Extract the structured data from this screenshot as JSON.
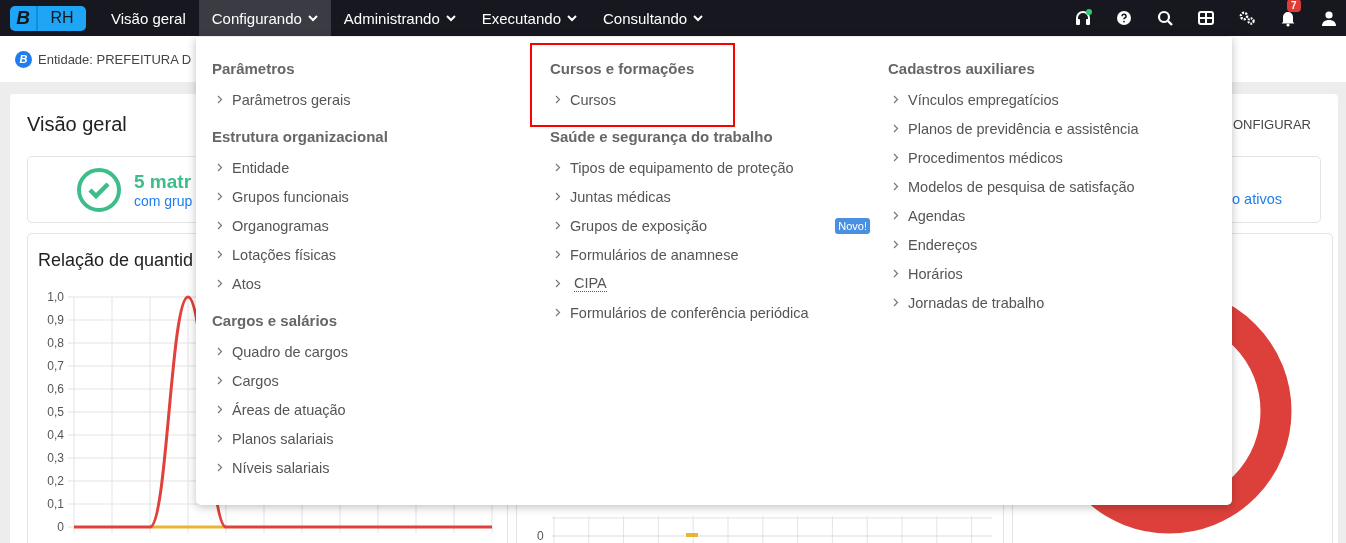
{
  "navbar": {
    "logo": {
      "letter": "B",
      "text": "RH"
    },
    "items": [
      {
        "label": "Visão geral",
        "selected": false,
        "dropdown": false
      },
      {
        "label": "Configurando",
        "selected": true,
        "dropdown": true
      },
      {
        "label": "Administrando",
        "selected": false,
        "dropdown": true
      },
      {
        "label": "Executando",
        "selected": false,
        "dropdown": true
      },
      {
        "label": "Consultando",
        "selected": false,
        "dropdown": true
      }
    ],
    "actions": [
      {
        "kind": "headset",
        "online": true
      },
      {
        "kind": "help"
      },
      {
        "kind": "search"
      },
      {
        "kind": "grid"
      },
      {
        "kind": "gears"
      },
      {
        "kind": "bell",
        "badge": "7"
      },
      {
        "kind": "user"
      }
    ]
  },
  "entity_bar": {
    "logo_letter": "B",
    "text": "Entidade: PREFEITURA D"
  },
  "overview": {
    "title": "Visão geral",
    "configure": "ONFIGURAR",
    "summary": {
      "count": "5 matr",
      "subtitle": "com grup",
      "right_link": "o ativos"
    },
    "line_chart": {
      "title": "Relação de quantid",
      "chart_data": {
        "type": "line",
        "grid": true,
        "series": [
          {
            "color": "#e0413a",
            "values": [
              0,
              0,
              0,
              1,
              0,
              0,
              0,
              0,
              0,
              0,
              0,
              0
            ]
          },
          {
            "color": "#e8b530",
            "values": [
              null,
              null,
              0,
              0,
              0,
              null,
              null,
              null,
              null,
              null,
              null,
              null
            ]
          }
        ],
        "ylim": [
          0,
          1
        ],
        "yticks": [
          {
            "value": 0,
            "label": "0"
          },
          {
            "value": 0.1,
            "label": "0,1"
          },
          {
            "value": 0.2,
            "label": "0,2"
          },
          {
            "value": 0.3,
            "label": "0,3"
          },
          {
            "value": 0.4,
            "label": "0,4"
          },
          {
            "value": 0.5,
            "label": "0,5"
          },
          {
            "value": 0.6,
            "label": "0,6"
          },
          {
            "value": 0.7,
            "label": "0,7"
          },
          {
            "value": 0.8,
            "label": "0,8"
          },
          {
            "value": 0.9,
            "label": "0,9"
          },
          {
            "value": 1,
            "label": "1,0"
          }
        ]
      }
    },
    "bar_chart": {
      "tick_label": "0"
    }
  },
  "menu": {
    "columns": [
      {
        "sections": [
          {
            "title": "Parâmetros",
            "highlighted": false,
            "items": [
              {
                "label": "Parâmetros gerais",
                "underlined": false
              }
            ]
          },
          {
            "title": "Estrutura organizacional",
            "highlighted": false,
            "items": [
              {
                "label": "Entidade",
                "underlined": false
              },
              {
                "label": "Grupos funcionais",
                "underlined": false
              },
              {
                "label": "Organogramas",
                "underlined": false
              },
              {
                "label": "Lotações físicas",
                "underlined": false
              },
              {
                "label": "Atos",
                "underlined": false
              }
            ]
          },
          {
            "title": "Cargos e salários",
            "highlighted": false,
            "items": [
              {
                "label": "Quadro de cargos",
                "underlined": false
              },
              {
                "label": "Cargos",
                "underlined": false
              },
              {
                "label": "Áreas de atuação",
                "underlined": false
              },
              {
                "label": "Planos salariais",
                "underlined": false
              },
              {
                "label": "Níveis salariais",
                "underlined": false
              }
            ]
          }
        ]
      },
      {
        "sections": [
          {
            "title": "Cursos e formações",
            "highlighted": true,
            "items": [
              {
                "label": "Cursos",
                "underlined": false
              }
            ]
          },
          {
            "title": "Saúde e segurança do trabalho",
            "highlighted": false,
            "items": [
              {
                "label": "Tipos de equipamento de proteção",
                "underlined": false
              },
              {
                "label": "Juntas médicas",
                "underlined": false
              },
              {
                "label": "Grupos de exposição",
                "underlined": false,
                "badge": "Novo!"
              },
              {
                "label": "Formulários de anamnese",
                "underlined": false
              },
              {
                "label": "CIPA",
                "underlined": true
              },
              {
                "label": "Formulários de conferência periódica",
                "underlined": false
              }
            ]
          }
        ]
      },
      {
        "sections": [
          {
            "title": "Cadastros auxiliares",
            "highlighted": false,
            "items": [
              {
                "label": "Vínculos empregatícios",
                "underlined": false
              },
              {
                "label": "Planos de previdência e assistência",
                "underlined": false
              },
              {
                "label": "Procedimentos médicos",
                "underlined": false
              },
              {
                "label": "Modelos de pesquisa de satisfação",
                "underlined": false
              },
              {
                "label": "Agendas",
                "underlined": false
              },
              {
                "label": "Endereços",
                "underlined": false
              },
              {
                "label": "Horários",
                "underlined": false
              },
              {
                "label": "Jornadas de trabalho",
                "underlined": false
              }
            ]
          }
        ]
      }
    ]
  }
}
